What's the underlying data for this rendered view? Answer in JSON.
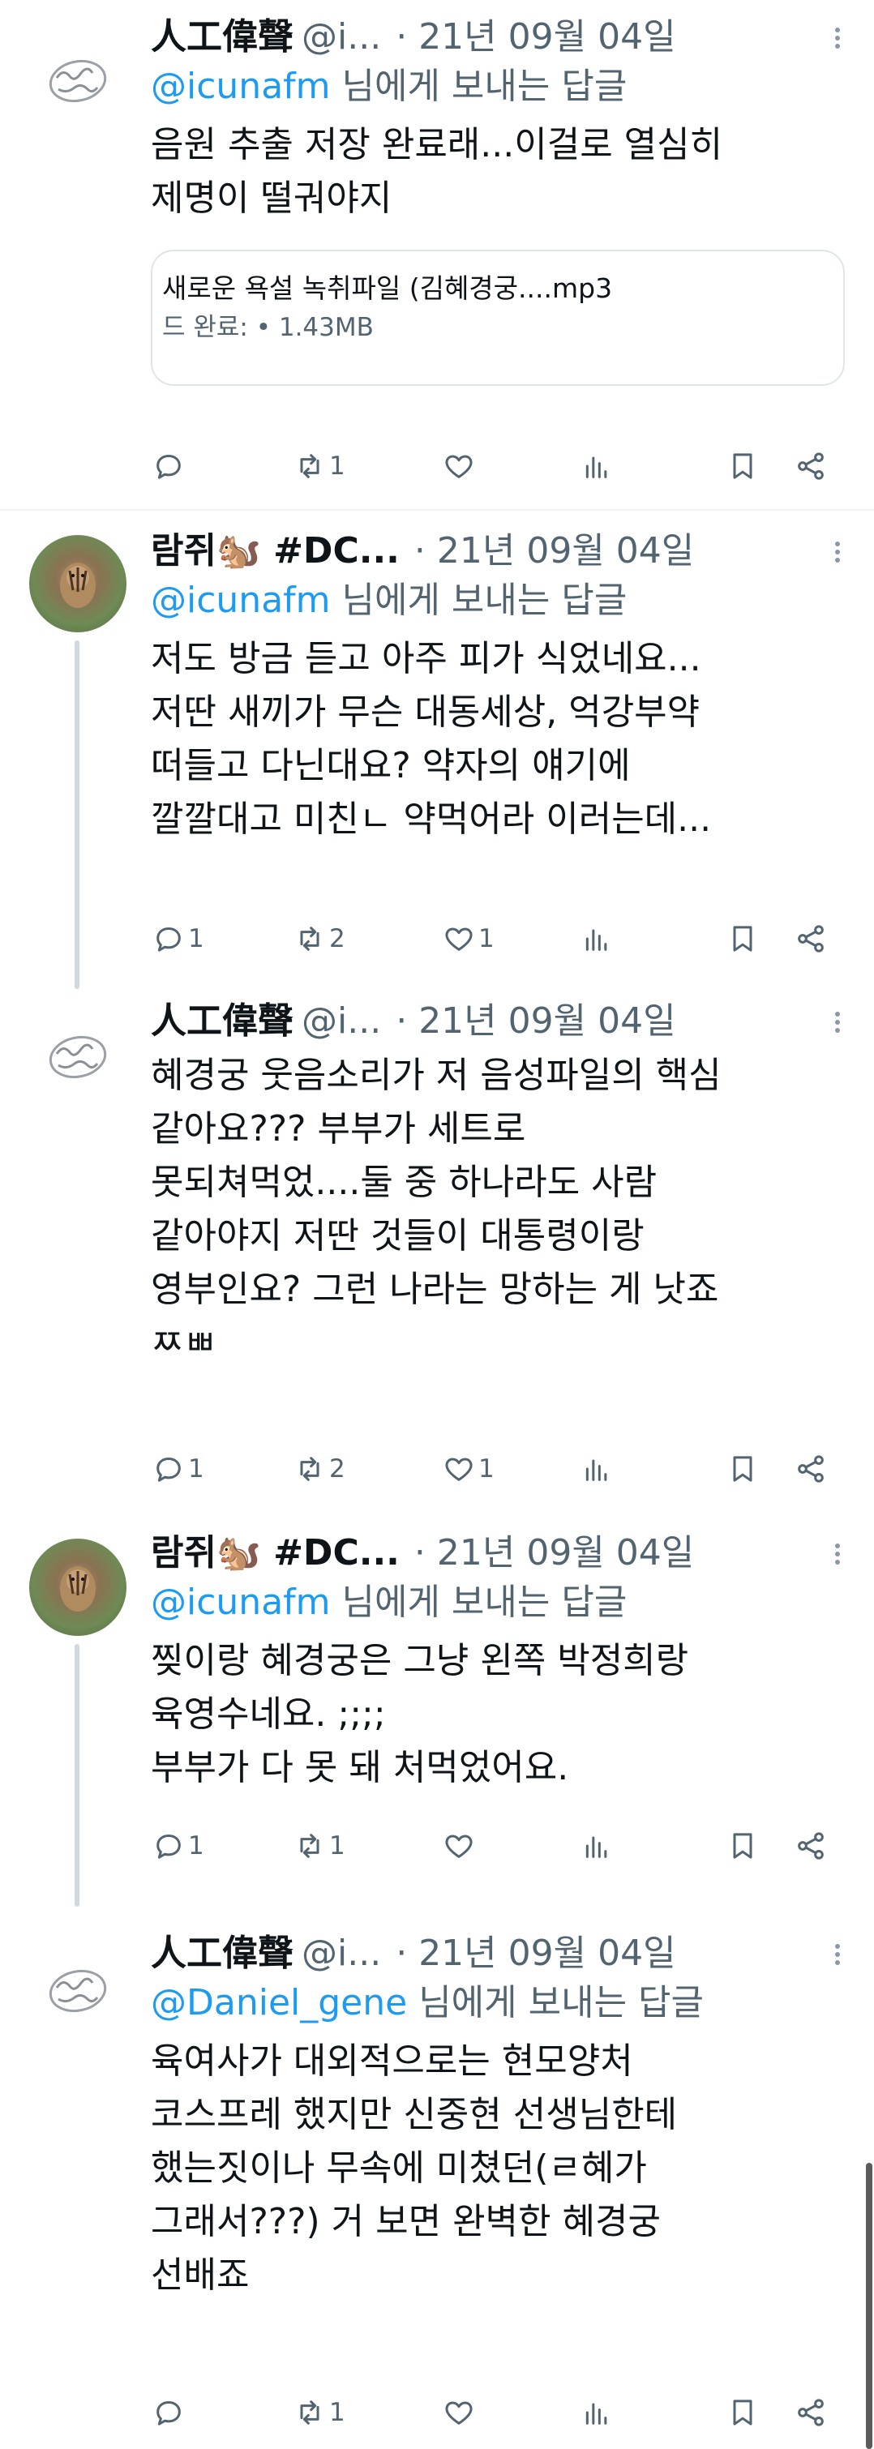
{
  "colors": {
    "text": "#0f1419",
    "muted": "#536471",
    "link": "#1d9bf0",
    "divider": "#eff3f4"
  },
  "tweets": [
    {
      "author": "人工偉聲",
      "handle": "@i...",
      "date": "21년 09월 04일",
      "reply_mention": "@icunafm",
      "reply_suffix": " 님에게 보내는 답글",
      "text": "음원 추출 저장 완료래...이걸로 열심히\n제명이  떨궈야지",
      "card": {
        "title": "새로운 욕설 녹취파일 (김혜경궁....mp3",
        "meta": "드 완료: • 1.43MB"
      },
      "counts": {
        "reply": "",
        "retweet": "1",
        "like": "",
        "views": ""
      }
    },
    {
      "author": "람쥐🐿️ #DC...",
      "handle": "",
      "date": "21년 09월 04일",
      "reply_mention": "@icunafm",
      "reply_suffix": " 님에게 보내는 답글",
      "text": "저도 방금 듣고 아주 피가 식었네요...\n저딴 새끼가 무슨 대동세상, 억강부약\n떠들고 다닌대요? 약자의 얘기에\n깔깔대고 미친ㄴ 약먹어라 이러는데...",
      "counts": {
        "reply": "1",
        "retweet": "2",
        "like": "1",
        "views": ""
      }
    },
    {
      "author": "人工偉聲",
      "handle": "@i...",
      "date": "21년 09월 04일",
      "text": "혜경궁 웃음소리가 저 음성파일의 핵심\n같아요??? 부부가 세트로\n못되쳐먹었....둘 중 하나라도 사람\n같아야지 저딴 것들이 대통령이랑\n영부인요? 그런 나라는 망하는 게 낫죠\nㅉㅃ",
      "counts": {
        "reply": "1",
        "retweet": "2",
        "like": "1",
        "views": ""
      }
    },
    {
      "author": "람쥐🐿️ #DC...",
      "handle": "",
      "date": "21년 09월 04일",
      "reply_mention": "@icunafm",
      "reply_suffix": " 님에게 보내는 답글",
      "text": "찢이랑 혜경궁은 그냥 왼쪽 박정희랑\n육영수네요. ;;;;\n부부가 다 못 돼 처먹었어요.",
      "counts": {
        "reply": "1",
        "retweet": "1",
        "like": "",
        "views": ""
      }
    },
    {
      "author": "人工偉聲",
      "handle": "@i...",
      "date": "21년 09월 04일",
      "reply_mention": "@Daniel_gene",
      "reply_suffix": " 님에게 보내는 답글",
      "text": "육여사가 대외적으로는 현모양처\n코스프레 했지만 신중현 선생님한테\n했는짓이나 무속에 미쳤던(ㄹ혜가\n그래서???) 거 보면 완벽한 혜경궁\n선배죠",
      "counts": {
        "reply": "",
        "retweet": "1",
        "like": "",
        "views": ""
      }
    }
  ]
}
